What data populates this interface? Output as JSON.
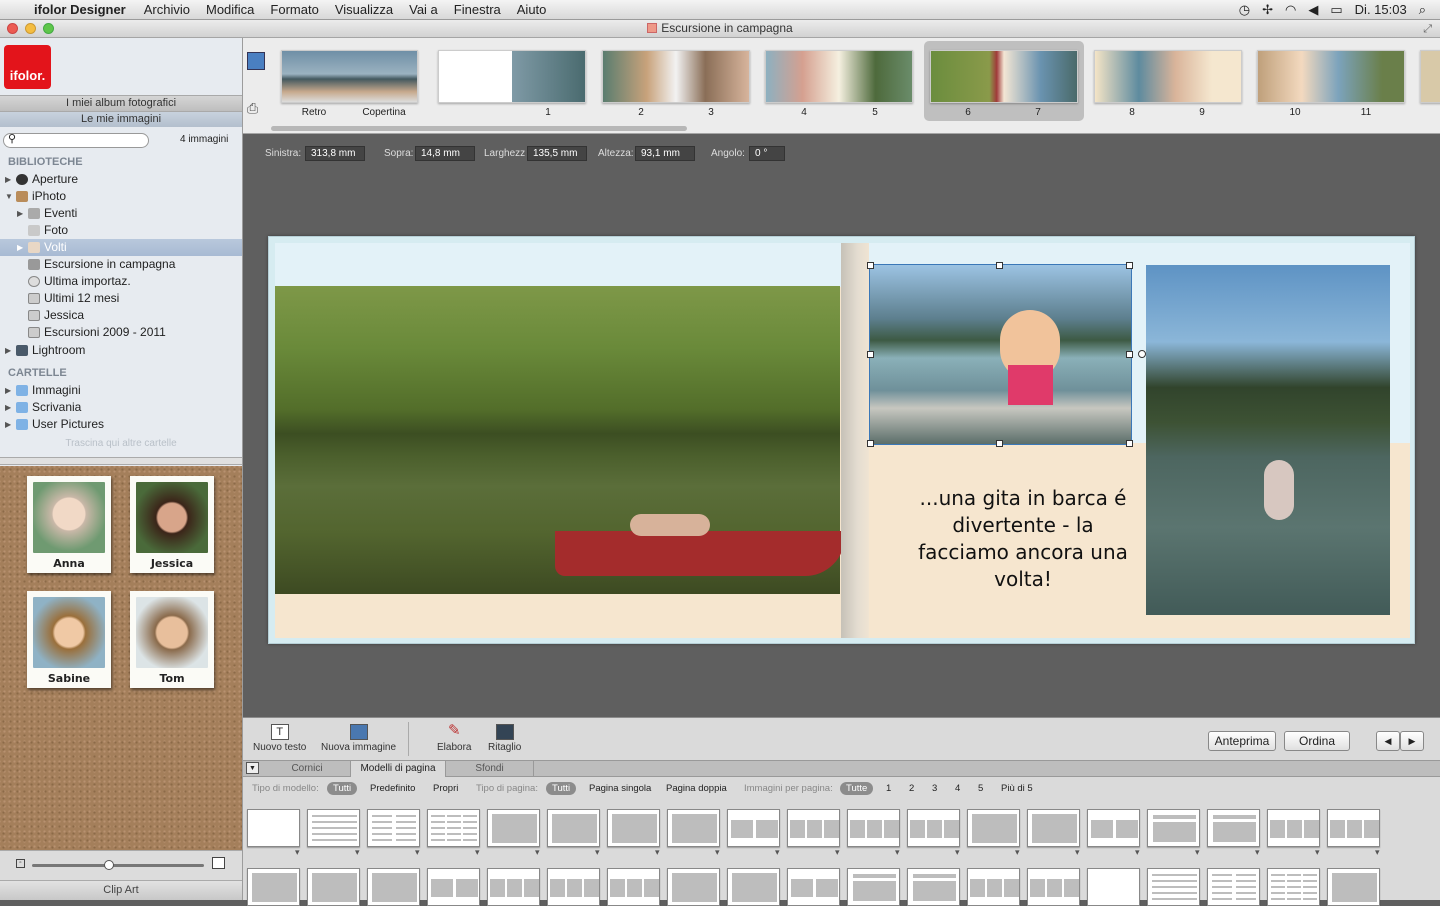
{
  "menubar": {
    "app": "ifolor Designer",
    "items": [
      "Archivio",
      "Modifica",
      "Formato",
      "Visualizza",
      "Vai a",
      "Finestra",
      "Aiuto"
    ],
    "clock": "Di. 15:03"
  },
  "window": {
    "title": "Escursione in campagna"
  },
  "sidebar": {
    "logo": "ifolor.",
    "albums_btn": "I miei album fotografici",
    "images_btn": "Le mie immagini",
    "search_placeholder": "",
    "count": "4 immagini",
    "libraries_header": "BIBLIOTECHE",
    "libraries": [
      {
        "label": "Aperture",
        "icon": "aperture-icon"
      },
      {
        "label": "iPhoto",
        "icon": "iphoto-icon"
      },
      {
        "label": "Eventi",
        "icon": "events-icon"
      },
      {
        "label": "Foto",
        "icon": "photos-icon"
      },
      {
        "label": "Volti",
        "icon": "faces-icon"
      },
      {
        "label": "Escursione in campagna",
        "icon": "event-icon"
      },
      {
        "label": "Ultima importaz.",
        "icon": "clock-icon"
      },
      {
        "label": "Ultimi 12 mesi",
        "icon": "calendar-icon"
      },
      {
        "label": "Jessica",
        "icon": "album-icon"
      },
      {
        "label": "Escursioni 2009 - 2011",
        "icon": "album-icon"
      },
      {
        "label": "Lightroom",
        "icon": "lightroom-icon"
      }
    ],
    "folders_header": "CARTELLE",
    "folders": [
      {
        "label": "Immagini"
      },
      {
        "label": "Scrivania"
      },
      {
        "label": "User Pictures"
      }
    ],
    "drop_hint": "Trascina qui altre cartelle",
    "faces": [
      {
        "name": "Anna"
      },
      {
        "name": "Jessica"
      },
      {
        "name": "Sabine"
      },
      {
        "name": "Tom"
      }
    ],
    "clip_art": "Clip Art",
    "zoom_level": 0.45
  },
  "pages": {
    "labels": [
      "Retro",
      "Copertina",
      "1",
      "2",
      "3",
      "4",
      "5",
      "6",
      "7",
      "8",
      "9",
      "10",
      "11"
    ]
  },
  "coords": {
    "left_label": "Sinistra:",
    "left_value": "313,8 mm",
    "top_label": "Sopra:",
    "top_value": "14,8 mm",
    "width_label": "Larghezz",
    "width_value": "135,5 mm",
    "height_label": "Altezza:",
    "height_value": "93,1 mm",
    "angle_label": "Angolo:",
    "angle_value": "0 °"
  },
  "spread": {
    "caption": "...una gita in barca é divertente - la facciamo ancora una volta!"
  },
  "toolbar": {
    "new_text": "Nuovo testo",
    "new_image": "Nuova immagine",
    "edit": "Elabora",
    "crop": "Ritaglio",
    "preview": "Anteprima",
    "order": "Ordina",
    "prev": "◀",
    "next": "▶"
  },
  "tabs": {
    "frames": "Cornici",
    "page_templates": "Modelli di pagina",
    "backgrounds": "Sfondi"
  },
  "filters": {
    "template_type_label": "Tipo di modello:",
    "all": "Tutti",
    "predefined": "Predefinito",
    "own": "Propri",
    "page_type_label": "Tipo di pagina:",
    "page_all": "Tutti",
    "single": "Pagina singola",
    "double": "Pagina doppia",
    "per_page_label": "Immagini per pagina:",
    "per_all": "Tutte",
    "n1": "1",
    "n2": "2",
    "n3": "3",
    "n4": "4",
    "n5": "5",
    "more": "Più di 5"
  },
  "colors": {
    "accent": "#e3141b",
    "selection": "#b5c8dd",
    "page_cream": "#f6e6cf",
    "page_blue": "#d6ecf1"
  }
}
